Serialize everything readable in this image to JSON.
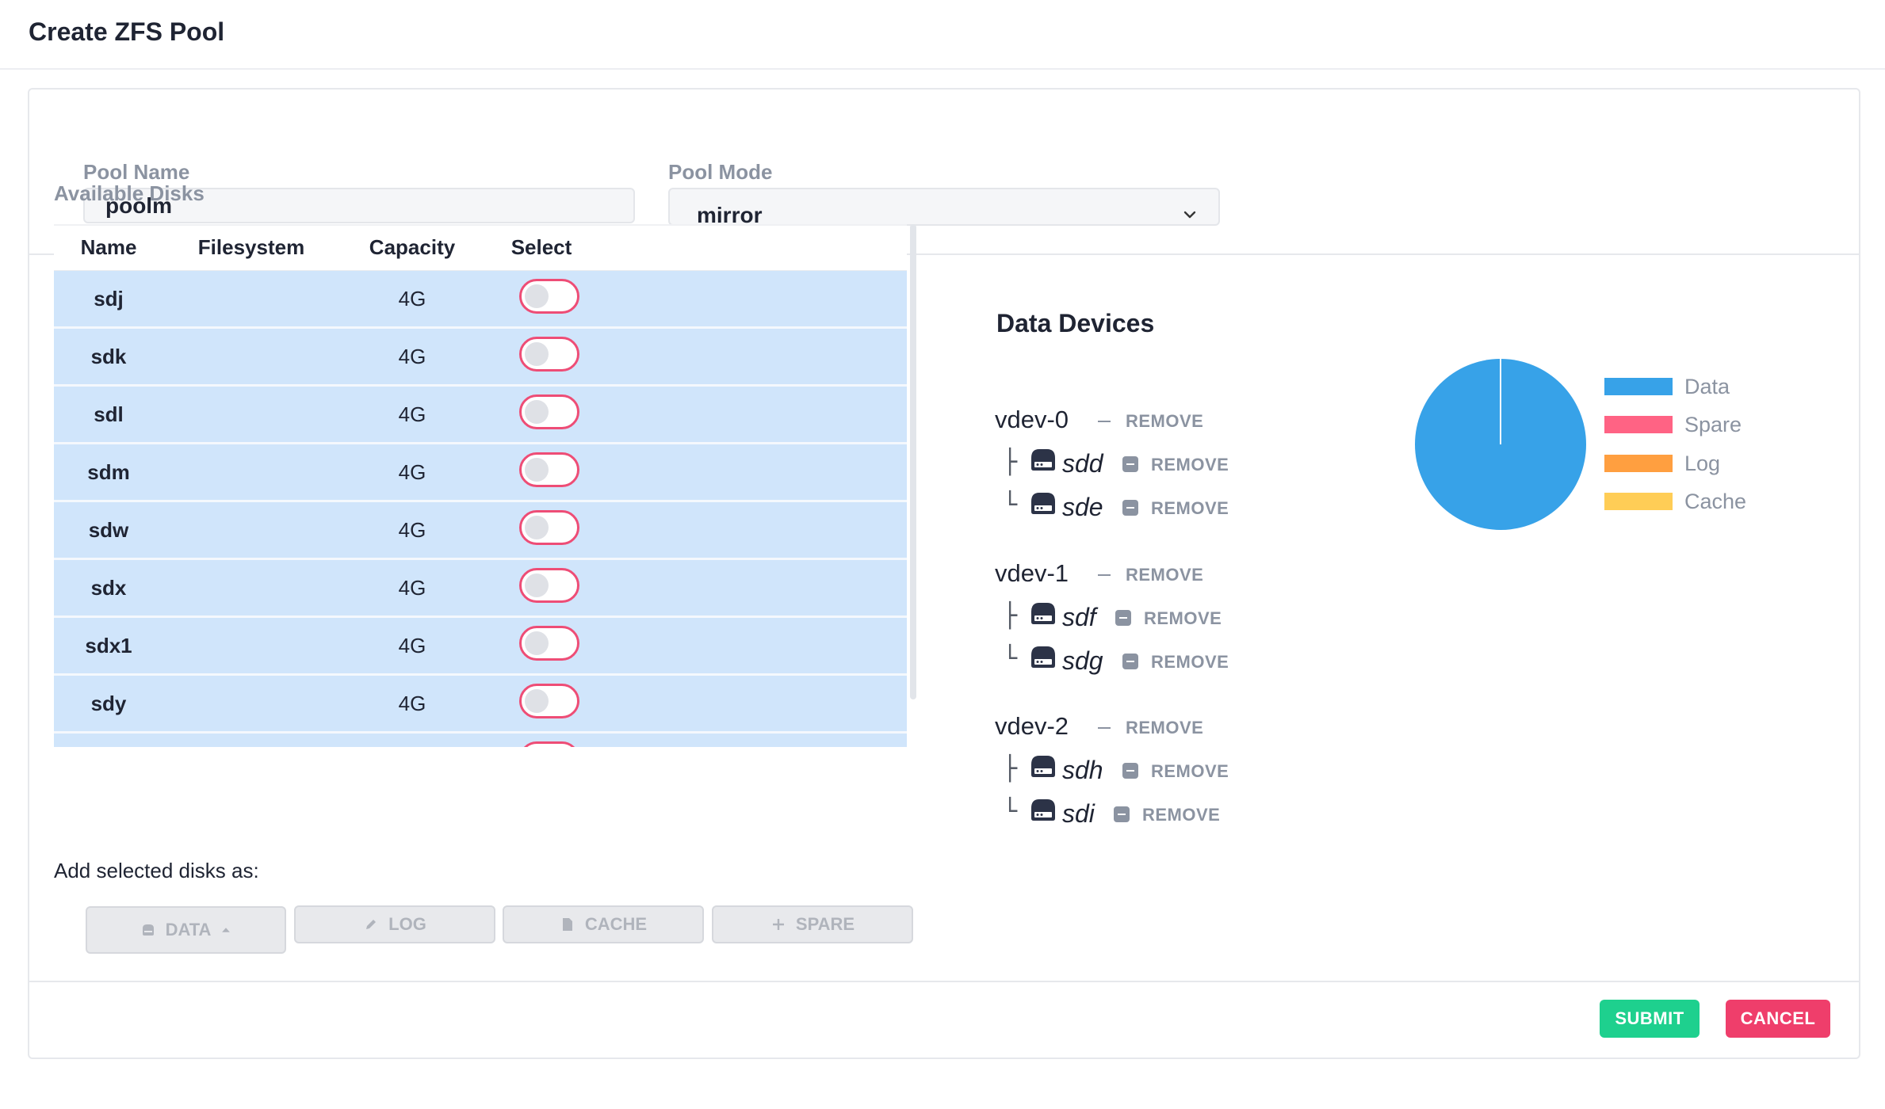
{
  "header": {
    "title": "Create ZFS Pool"
  },
  "form": {
    "pool_name_label": "Pool Name",
    "pool_name_value": "poolm",
    "pool_mode_label": "Pool Mode",
    "pool_mode_value": "mirror"
  },
  "available_disks": {
    "label": "Available Disks",
    "columns": [
      "Name",
      "Filesystem",
      "Capacity",
      "Select"
    ],
    "rows": [
      {
        "name": "sdj",
        "filesystem": "",
        "capacity": "4G",
        "selected": false
      },
      {
        "name": "sdk",
        "filesystem": "",
        "capacity": "4G",
        "selected": false
      },
      {
        "name": "sdl",
        "filesystem": "",
        "capacity": "4G",
        "selected": false
      },
      {
        "name": "sdm",
        "filesystem": "",
        "capacity": "4G",
        "selected": false
      },
      {
        "name": "sdw",
        "filesystem": "",
        "capacity": "4G",
        "selected": false
      },
      {
        "name": "sdx",
        "filesystem": "",
        "capacity": "4G",
        "selected": false
      },
      {
        "name": "sdx1",
        "filesystem": "",
        "capacity": "4G",
        "selected": false
      },
      {
        "name": "sdy",
        "filesystem": "",
        "capacity": "4G",
        "selected": false
      }
    ]
  },
  "add_disks": {
    "label": "Add selected disks as:",
    "buttons": [
      "DATA",
      "LOG",
      "CACHE",
      "SPARE"
    ]
  },
  "data_devices": {
    "title": "Data Devices",
    "remove_label": "REMOVE",
    "vdevs": [
      {
        "name": "vdev-0",
        "disks": [
          "sdd",
          "sde"
        ]
      },
      {
        "name": "vdev-1",
        "disks": [
          "sdf",
          "sdg"
        ]
      },
      {
        "name": "vdev-2",
        "disks": [
          "sdh",
          "sdi"
        ]
      }
    ]
  },
  "chart_data": {
    "type": "pie",
    "categories": [
      "Data",
      "Spare",
      "Log",
      "Cache"
    ],
    "values": [
      6,
      0,
      0,
      0
    ],
    "colors": [
      "#37a2e8",
      "#ff6384",
      "#ff9f40",
      "#ffcd56"
    ],
    "legend": "right"
  },
  "footer": {
    "submit_label": "SUBMIT",
    "cancel_label": "CANCEL"
  },
  "colors": {
    "submit": "#1ed08e",
    "cancel": "#ef3e6b",
    "row_bg": "#d0e5fb",
    "toggle_border": "#ee4d76"
  }
}
